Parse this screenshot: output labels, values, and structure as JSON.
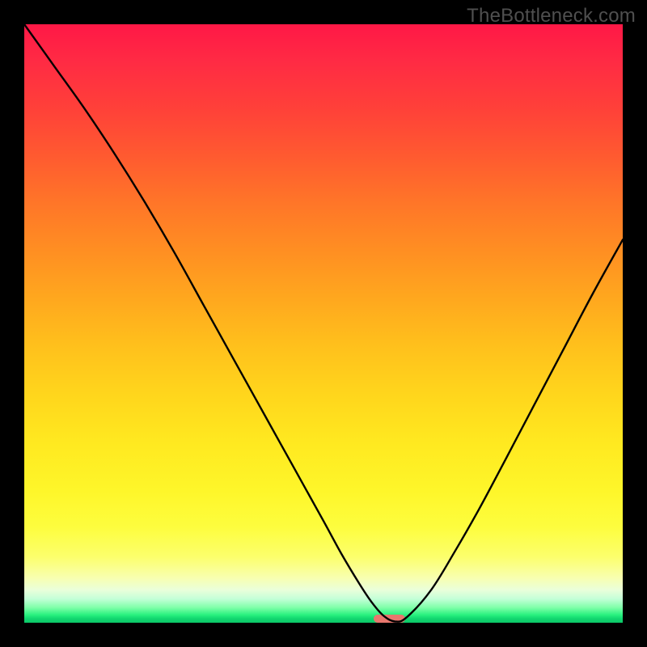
{
  "watermark": "TheBottleneck.com",
  "chart_data": {
    "type": "line",
    "title": "",
    "xlabel": "",
    "ylabel": "",
    "xlim": [
      0,
      100
    ],
    "ylim": [
      0,
      100
    ],
    "grid": false,
    "legend": false,
    "series": [
      {
        "name": "bottleneck-curve",
        "x": [
          0,
          5,
          10,
          15,
          20,
          25,
          30,
          35,
          40,
          45,
          50,
          53,
          56,
          58,
          60,
          62,
          64,
          68,
          72,
          76,
          80,
          85,
          90,
          95,
          100
        ],
        "values": [
          100,
          93,
          86,
          78.5,
          70.5,
          62,
          53,
          44,
          35,
          26,
          17,
          11.5,
          6.5,
          3.5,
          1.2,
          0.2,
          1.0,
          5.5,
          12,
          19,
          26.5,
          36,
          45.5,
          55,
          64
        ]
      }
    ],
    "marker": {
      "name": "optimal-marker",
      "x": 61,
      "width_pct": 5.2,
      "height_pct": 1.3,
      "color": "#e8776e"
    },
    "background_gradient": {
      "top": "#ff1846",
      "mid": "#ffe920",
      "bottom": "#0cc767"
    }
  }
}
